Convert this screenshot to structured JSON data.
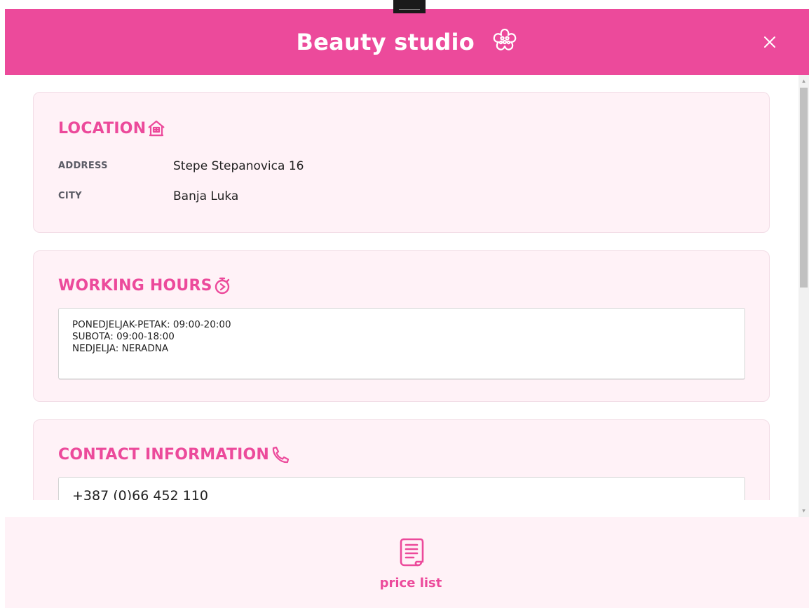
{
  "header": {
    "title": "Beauty studio",
    "close_icon": "close-icon",
    "title_icon": "flower-icon"
  },
  "location": {
    "title": "LOCATION",
    "icon": "house-icon",
    "rows": [
      {
        "label": "ADDRESS",
        "value": "Stepe Stepanovica 16"
      },
      {
        "label": "CITY",
        "value": "Banja Luka"
      }
    ]
  },
  "working_hours": {
    "title": "WORKING HOURS",
    "icon": "stopwatch-icon",
    "lines": [
      "PONEDJELJAK-PETAK: 09:00-20:00",
      "SUBOTA: 09:00-18:00",
      "NEDJELJA: NERADNA"
    ]
  },
  "contact": {
    "title": "CONTACT INFORMATION",
    "icon": "phone-icon",
    "phone": "+387 (0)66 452 110"
  },
  "footer": {
    "price_list_label": "price list",
    "price_list_icon": "scroll-document-icon"
  },
  "colors": {
    "accent": "#ec4a9b",
    "card_bg": "#fff2f7",
    "text": "#222222"
  }
}
